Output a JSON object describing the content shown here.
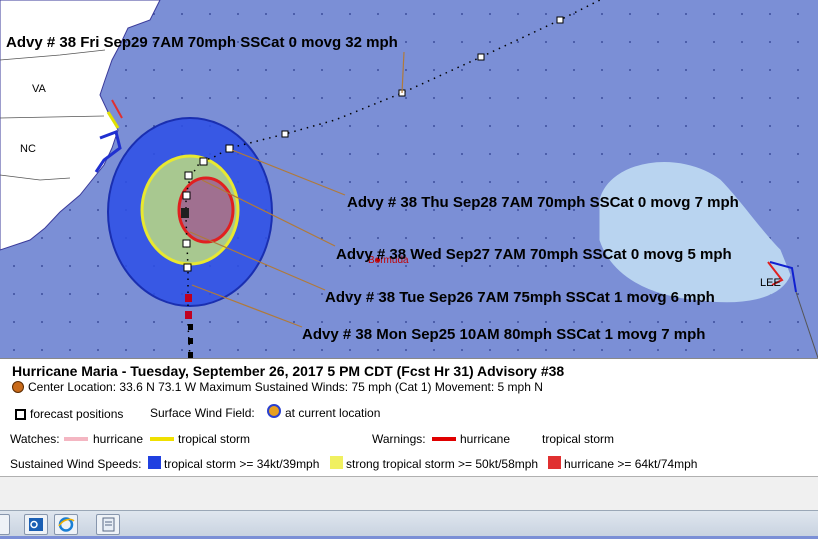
{
  "map": {
    "callouts": [
      "Advy # 38 Fri Sep29 7AM  70mph SSCat 0 movg 32 mph",
      "Advy # 38 Thu Sep28 7AM  70mph SSCat 0 movg 7 mph",
      "Advy # 38 Wed Sep27 7AM  70mph SSCat 0 movg 5 mph",
      "Advy # 38 Tue Sep26 7AM  75mph SSCat 1 movg 6 mph",
      "Advy # 38 Mon Sep25 10AM  80mph SSCat 1 movg 7 mph"
    ],
    "state_labels": [
      "VA",
      "NC"
    ],
    "island_label": "Bermuda",
    "storm_label": "LEE",
    "colors": {
      "ocean": "#7b8fd6",
      "land": "#ffffff",
      "ts_wind": "#3050e0",
      "strong_ts_wind": "#e8e870",
      "hurricane_wind": "#e04040",
      "lee_cone": "#b9d4f0"
    }
  },
  "legend": {
    "title": "Hurricane Maria  -  Tuesday, September 26, 2017  5 PM CDT (Fcst Hr 31)   Advisory #38",
    "center_location": "Center Location: 33.6 N  73.1 W   Maximum Sustained Winds: 75 mph (Cat 1) Movement: 5 mph N",
    "forecast_positions": "forecast positions",
    "surface_wind_field": "Surface Wind Field:",
    "at_current_location": "at current location",
    "watches_label": "Watches:",
    "watch_hurricane": "hurricane",
    "watch_tropical_storm": "tropical storm",
    "warnings_label": "Warnings:",
    "warning_hurricane": "hurricane",
    "warning_tropical_storm": "tropical storm",
    "sustained_label": "Sustained Wind Speeds:",
    "ts_wind": "tropical storm >= 34kt/39mph",
    "strong_ts_wind": "strong tropical storm >= 50kt/58mph",
    "hurricane_wind": "hurricane >= 64kt/74mph",
    "colors": {
      "watch_hurricane": "#f4b6c2",
      "watch_tropical_storm": "#f0e000",
      "warning_hurricane": "#e00000",
      "ts_swatch": "#2040e0",
      "strong_ts_swatch": "#f0f060",
      "hurricane_swatch": "#e03030"
    }
  },
  "taskbar": {
    "icons": [
      "windows-flag-icon",
      "outlook-icon",
      "internet-explorer-icon",
      "document-icon"
    ]
  }
}
